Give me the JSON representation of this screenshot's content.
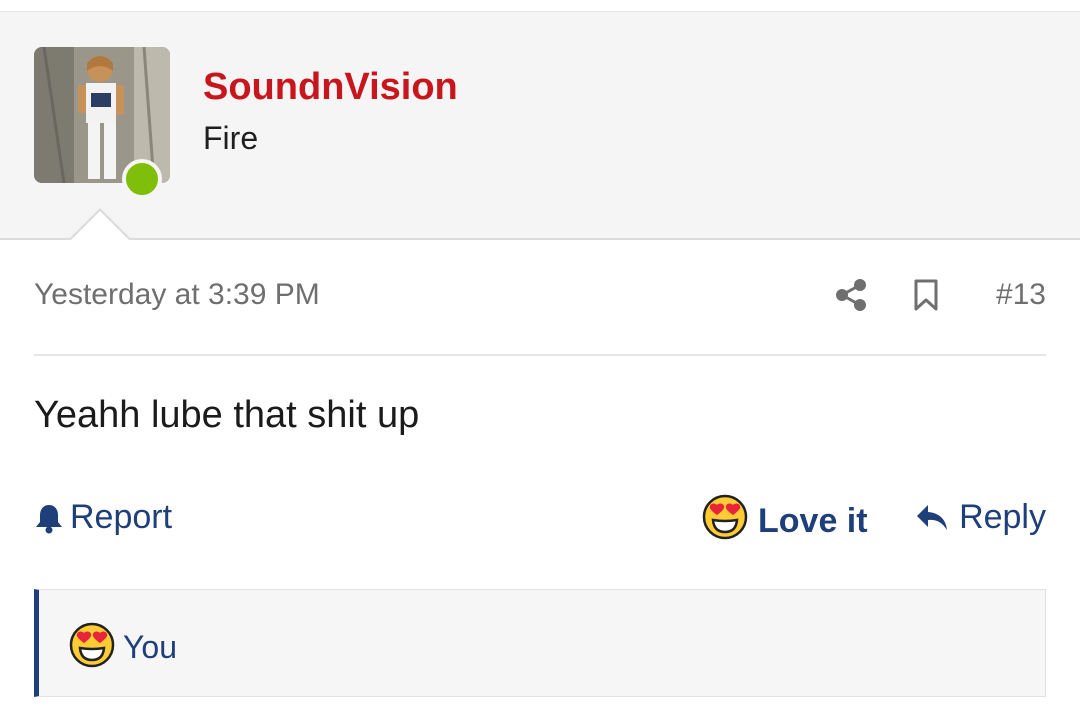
{
  "post": {
    "username": "SoundnVision",
    "user_title": "Fire",
    "timestamp": "Yesterday at 3:39 PM",
    "post_number": "#13",
    "body": "Yeahh lube that shit up"
  },
  "actions": {
    "report_label": "Report",
    "love_label": "Love it",
    "reply_label": "Reply"
  },
  "reactions": {
    "user": "You",
    "emoji": "heart-eyes"
  },
  "icons": {
    "share": "share-icon",
    "bookmark": "bookmark-icon",
    "report": "bell-icon",
    "reply": "reply-arrow-icon",
    "online": "online-status-dot"
  },
  "colors": {
    "username": "#c8161d",
    "accent": "#1e3f7a",
    "online": "#7fbe0a",
    "muted": "#6f6f6f"
  }
}
